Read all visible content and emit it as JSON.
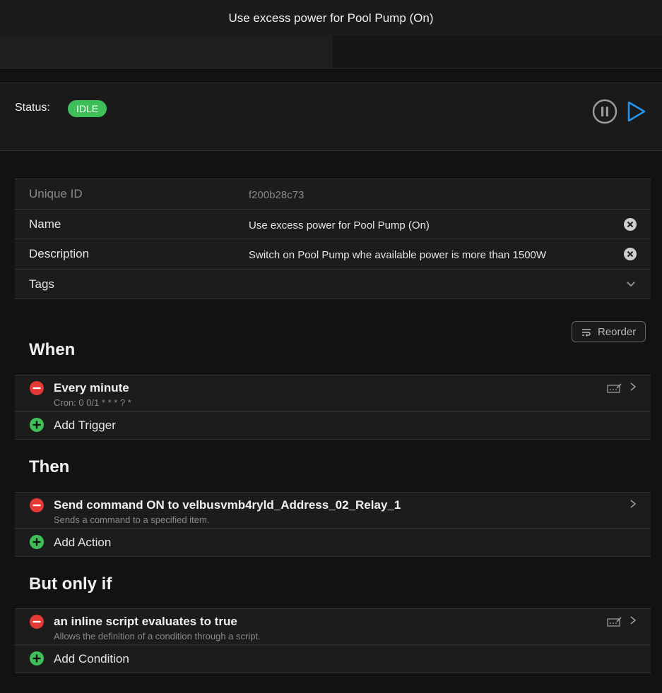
{
  "header": {
    "title": "Use excess power for Pool Pump (On)"
  },
  "status": {
    "label": "Status:",
    "badge": "IDLE",
    "badge_color": "#3fbf5a",
    "pause_icon": "pause-circle-icon",
    "play_icon": "play-icon",
    "play_color": "#2196f3"
  },
  "info": {
    "unique_id_label": "Unique ID",
    "unique_id_value": "f200b28c73",
    "name_label": "Name",
    "name_value": "Use excess power for Pool Pump (On)",
    "description_label": "Description",
    "description_value": "Switch on Pool Pump whe available power is more than 1500W",
    "tags_label": "Tags"
  },
  "reorder": {
    "label": "Reorder"
  },
  "when": {
    "title": "When",
    "items": [
      {
        "title": "Every minute",
        "subtitle": "Cron: 0 0/1 * * * ? *"
      }
    ],
    "add_label": "Add Trigger"
  },
  "then": {
    "title": "Then",
    "items": [
      {
        "title": "Send command ON to velbusvmb4ryld_Address_02_Relay_1",
        "subtitle": "Sends a command to a specified item."
      }
    ],
    "add_label": "Add Action"
  },
  "but_only_if": {
    "title": "But only if",
    "items": [
      {
        "title": "an inline script evaluates to true",
        "subtitle": "Allows the definition of a condition through a script."
      }
    ],
    "add_label": "Add Condition"
  },
  "colors": {
    "remove": "#e53935",
    "add": "#3fbf5a",
    "background": "#121212"
  }
}
